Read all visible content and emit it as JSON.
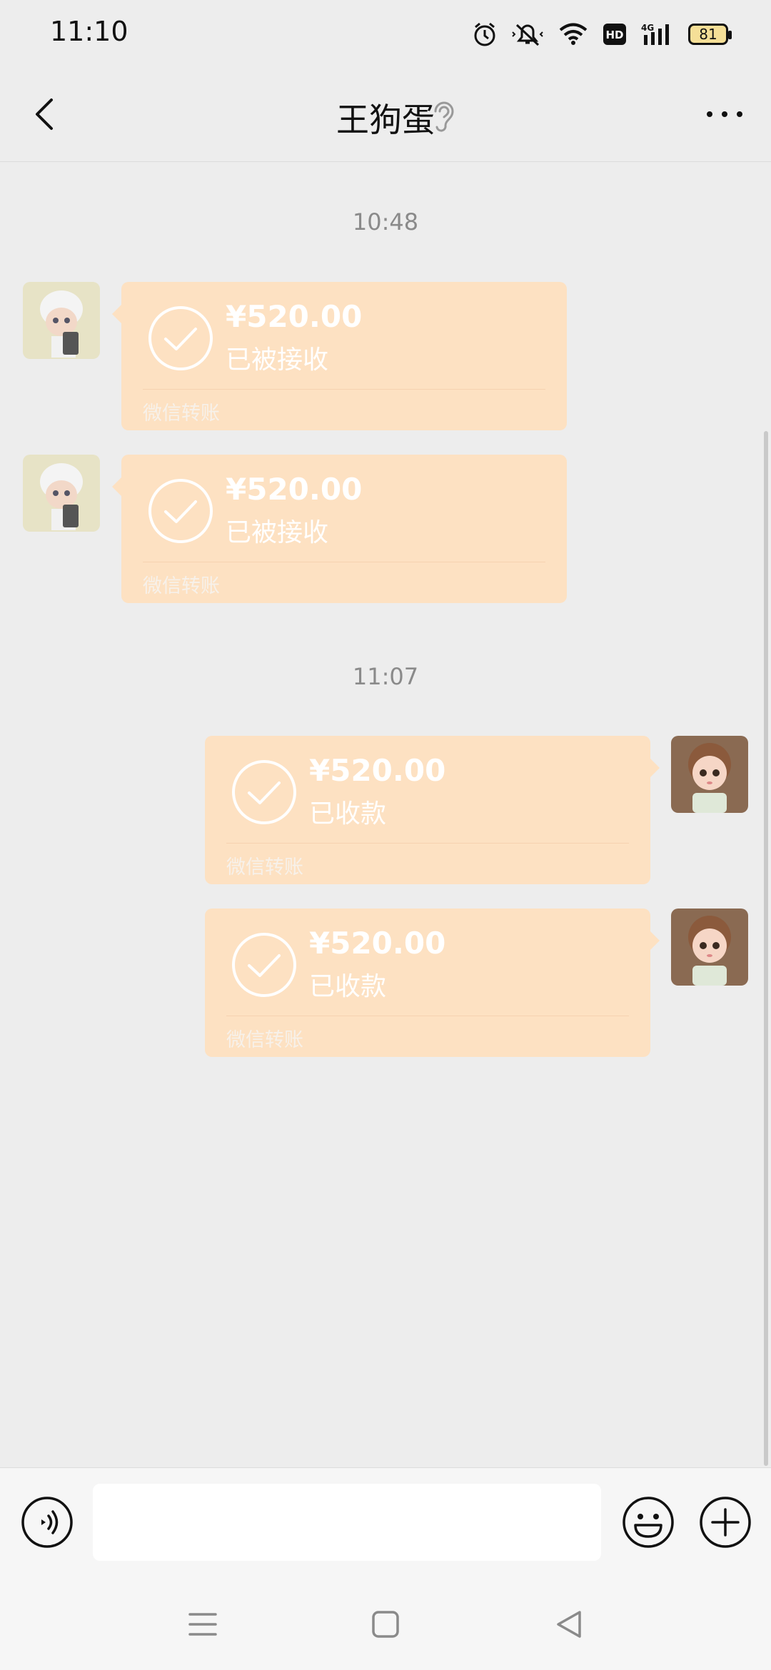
{
  "status_bar": {
    "time": "11:10",
    "battery": "81",
    "network": "4G",
    "hd": "HD",
    "icons": [
      "alarm-icon",
      "mute-icon",
      "wifi-icon",
      "hd-icon",
      "signal-icon",
      "battery-icon"
    ]
  },
  "header": {
    "title": "王狗蛋",
    "icons": [
      "back-icon",
      "ear-icon",
      "more-icon"
    ]
  },
  "chat": {
    "groups": [
      {
        "time": "10:48",
        "messages": [
          {
            "side": "left",
            "amount": "¥520.00",
            "status": "已被接收",
            "footer": "微信转账"
          },
          {
            "side": "left",
            "amount": "¥520.00",
            "status": "已被接收",
            "footer": "微信转账"
          }
        ]
      },
      {
        "time": "11:07",
        "messages": [
          {
            "side": "right",
            "amount": "¥520.00",
            "status": "已收款",
            "footer": "微信转账"
          },
          {
            "side": "right",
            "amount": "¥520.00",
            "status": "已收款",
            "footer": "微信转账"
          }
        ]
      }
    ]
  },
  "input_bar": {
    "value": "",
    "icons": [
      "voice-icon",
      "emoji-icon",
      "plus-icon"
    ]
  },
  "system_nav": {
    "icons": [
      "menu-icon",
      "home-icon",
      "back-triangle-icon"
    ]
  },
  "colors": {
    "background": "#ededed",
    "bubble": "#fde1c2",
    "text_white": "#ffffff"
  }
}
